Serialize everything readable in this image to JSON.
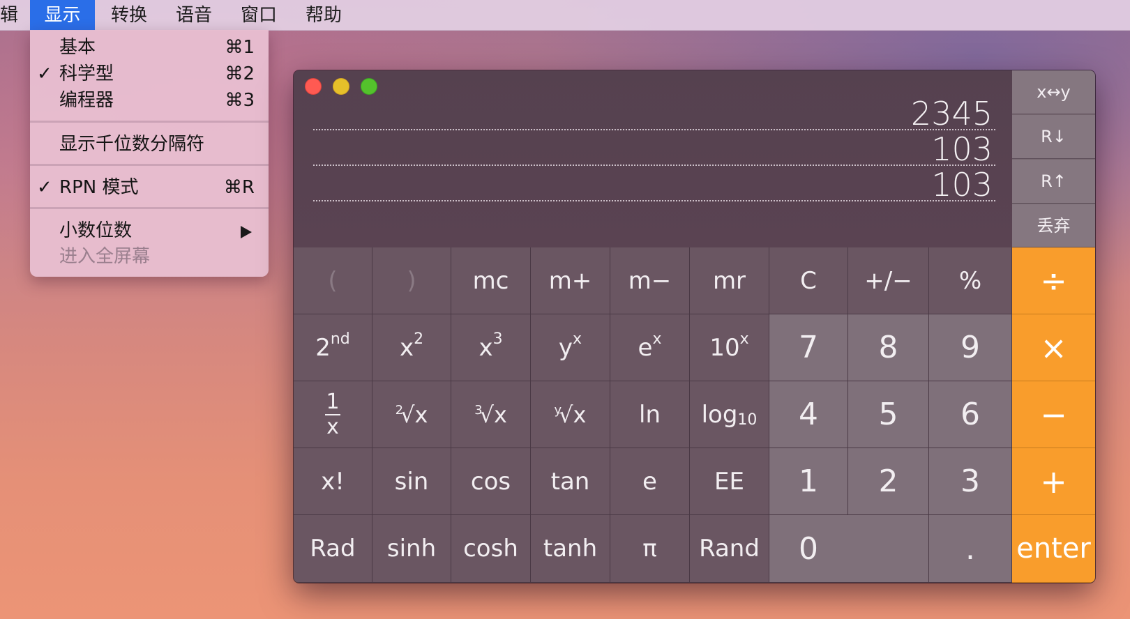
{
  "menubar": {
    "items": [
      "辑",
      "显示",
      "转换",
      "语音",
      "窗口",
      "帮助"
    ],
    "active": "显示"
  },
  "menu": {
    "basic": {
      "label": "基本",
      "shortcut": "⌘1",
      "checked": false
    },
    "scientific": {
      "label": "科学型",
      "shortcut": "⌘2",
      "checked": true
    },
    "programmer": {
      "label": "编程器",
      "shortcut": "⌘3",
      "checked": false
    },
    "thousands": {
      "label": "显示千位数分隔符"
    },
    "rpn": {
      "label": "RPN 模式",
      "shortcut": "⌘R",
      "checked": true
    },
    "decimals": {
      "label": "小数位数",
      "has_submenu": true
    },
    "fullscreen": {
      "label": "进入全屏幕",
      "enabled": false
    },
    "check_glyph": "✓"
  },
  "display": {
    "stack": [
      "2345",
      "103",
      "103"
    ]
  },
  "stack_buttons": {
    "swap": "x↔y",
    "roll_down": "R↓",
    "roll_up": "R↑",
    "drop": "丢弃"
  },
  "keys": {
    "open_paren": "(",
    "close_paren": ")",
    "mc": "mc",
    "m_plus": "m+",
    "m_minus": "m−",
    "mr": "mr",
    "clear": "C",
    "plus_minus": "+/−",
    "percent": "%",
    "divide": "÷",
    "second": {
      "base": "2",
      "sup": "nd"
    },
    "x_squared": {
      "base": "x",
      "sup": "2"
    },
    "x_cubed": {
      "base": "x",
      "sup": "3"
    },
    "y_pow_x": {
      "base": "y",
      "sup": "x"
    },
    "e_pow_x": {
      "base": "e",
      "sup": "x"
    },
    "ten_pow_x": {
      "base": "10",
      "sup": "x"
    },
    "seven": "7",
    "eight": "8",
    "nine": "9",
    "multiply": "×",
    "reciprocal": {
      "num": "1",
      "den": "x"
    },
    "sqrt": {
      "index": "2",
      "body": "√x"
    },
    "cbrt": {
      "index": "3",
      "body": "√x"
    },
    "yroot": {
      "index": "y",
      "body": "√x"
    },
    "ln": "ln",
    "log10": {
      "base": "log",
      "sub": "10"
    },
    "four": "4",
    "five": "5",
    "six": "6",
    "subtract": "−",
    "factorial": "x!",
    "sin": "sin",
    "cos": "cos",
    "tan": "tan",
    "e": "e",
    "ee": "EE",
    "one": "1",
    "two": "2",
    "three": "3",
    "add": "+",
    "rad": "Rad",
    "sinh": "sinh",
    "cosh": "cosh",
    "tanh": "tanh",
    "pi": "π",
    "rand": "Rand",
    "zero": "0",
    "decimal": ".",
    "enter": "enter"
  },
  "colors": {
    "operator": "#f99d2c",
    "menu_highlight": "#2a6ee8",
    "close": "#ff5a52",
    "minimize": "#e6c02a",
    "zoom": "#54c22c"
  }
}
